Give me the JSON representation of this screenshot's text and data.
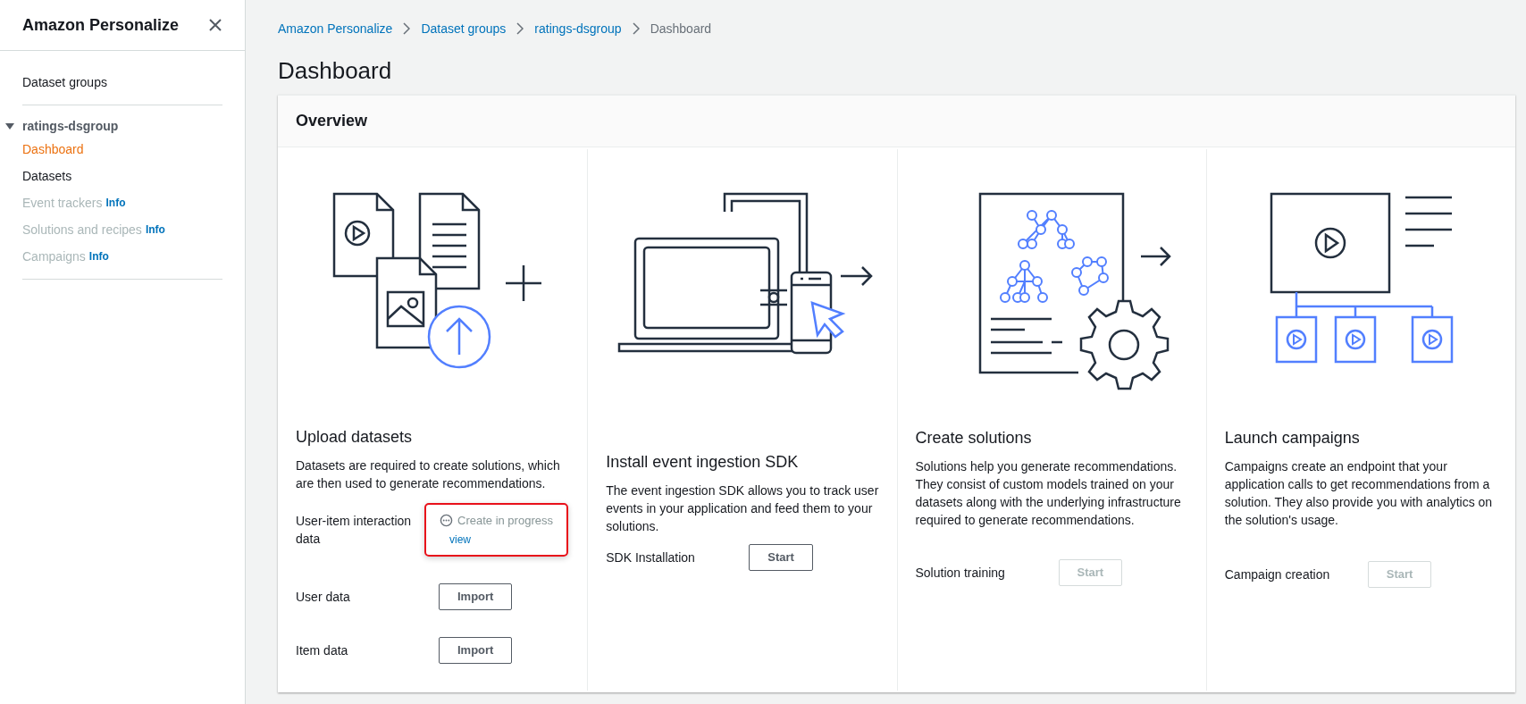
{
  "sidebar": {
    "title": "Amazon Personalize",
    "top_link": {
      "label": "Dataset groups"
    },
    "group": {
      "label": "ratings-dsgroup",
      "expanded": true,
      "items": [
        {
          "label": "Dashboard",
          "selected": true,
          "disabled": false
        },
        {
          "label": "Datasets",
          "selected": false,
          "disabled": false
        },
        {
          "label": "Event trackers",
          "selected": false,
          "disabled": true,
          "badge": "Info"
        },
        {
          "label": "Solutions and recipes",
          "selected": false,
          "disabled": true,
          "badge": "Info"
        },
        {
          "label": "Campaigns",
          "selected": false,
          "disabled": true,
          "badge": "Info"
        }
      ]
    }
  },
  "breadcrumbs": [
    {
      "label": "Amazon Personalize",
      "link": true
    },
    {
      "label": "Dataset groups",
      "link": true
    },
    {
      "label": "ratings-dsgroup",
      "link": true
    },
    {
      "label": "Dashboard",
      "link": false
    }
  ],
  "page_title": "Dashboard",
  "overview": {
    "title": "Overview",
    "steps": [
      {
        "title": "Upload datasets",
        "description": "Datasets are required to create solutions, which are then used to generate recommendations.",
        "rows": [
          {
            "label": "User-item interaction data",
            "kind": "status",
            "status": "Create in progress",
            "link": "view",
            "highlighted": true
          },
          {
            "label": "User data",
            "kind": "button",
            "button": "Import",
            "disabled": false
          },
          {
            "label": "Item data",
            "kind": "button",
            "button": "Import",
            "disabled": false
          }
        ]
      },
      {
        "title": "Install event ingestion SDK",
        "description": "The event ingestion SDK allows you to track user events in your application and feed them to your solutions.",
        "rows": [
          {
            "label": "SDK Installation",
            "kind": "button",
            "button": "Start",
            "disabled": false
          }
        ]
      },
      {
        "title": "Create solutions",
        "description": "Solutions help you generate recommendations. They consist of custom models trained on your datasets along with the underlying infrastructure required to generate recommendations.",
        "rows": [
          {
            "label": "Solution training",
            "kind": "button",
            "button": "Start",
            "disabled": true
          }
        ]
      },
      {
        "title": "Launch campaigns",
        "description": "Campaigns create an endpoint that your application calls to get recommendations from a solution. They also provide you with analytics on the solution's usage.",
        "rows": [
          {
            "label": "Campaign creation",
            "kind": "button",
            "button": "Start",
            "disabled": true
          }
        ]
      }
    ]
  }
}
